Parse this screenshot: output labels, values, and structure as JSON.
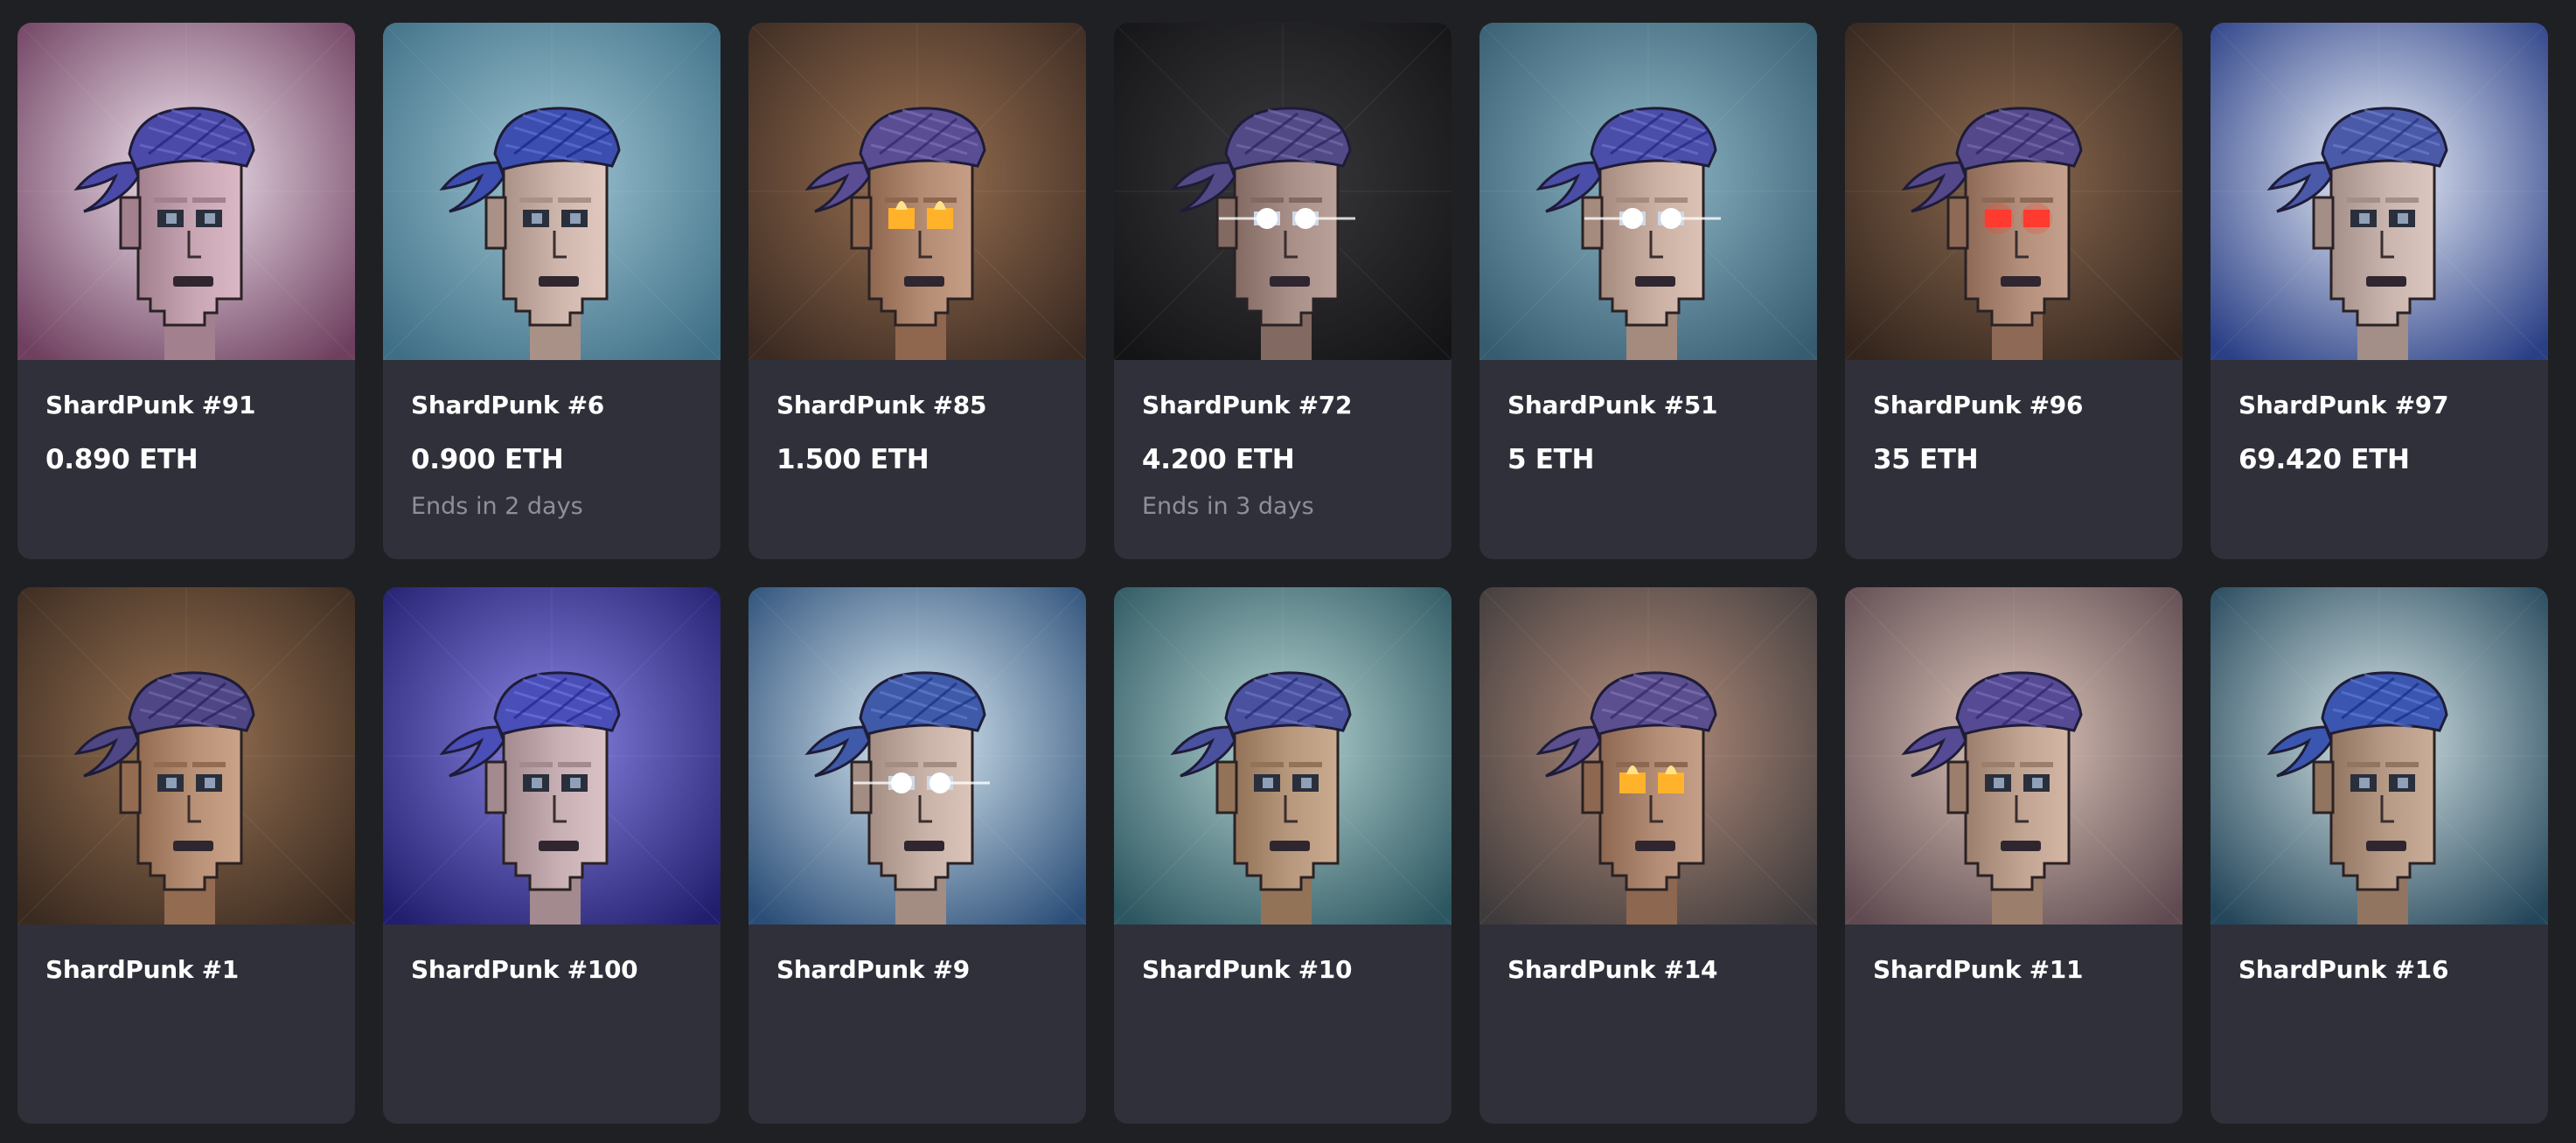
{
  "cards": [
    {
      "name": "ShardPunk #91",
      "price": "0.890 ETH",
      "ends": "",
      "bg1": "#f1e6f0",
      "bg2": "#6e3f5f",
      "bandana": "#4c4aa8",
      "skin": "#c9a6b4",
      "eyes": "normal"
    },
    {
      "name": "ShardPunk #6",
      "price": "0.900 ETH",
      "ends": "Ends in 2 days",
      "bg1": "#9fc6d4",
      "bg2": "#3f6f86",
      "bandana": "#3c4fb0",
      "skin": "#d0b7ad",
      "eyes": "normal"
    },
    {
      "name": "ShardPunk #85",
      "price": "1.500 ETH",
      "ends": "",
      "bg1": "#9b7252",
      "bg2": "#3b2a22",
      "bandana": "#5a4d94",
      "skin": "#b58c74",
      "eyes": "fire"
    },
    {
      "name": "ShardPunk #72",
      "price": "4.200 ETH",
      "ends": "Ends in 3 days",
      "bg1": "#3a3a3e",
      "bg2": "#141416",
      "bandana": "#514a86",
      "skin": "#a88f87",
      "eyes": "laser"
    },
    {
      "name": "ShardPunk #51",
      "price": "5 ETH",
      "ends": "",
      "bg1": "#8fb8c7",
      "bg2": "#365c70",
      "bandana": "#4a4ea8",
      "skin": "#cbb0a4",
      "eyes": "laser"
    },
    {
      "name": "ShardPunk #96",
      "price": "35 ETH",
      "ends": "",
      "bg1": "#8c6a50",
      "bg2": "#33251d",
      "bandana": "#55488a",
      "skin": "#b4907c",
      "eyes": "red"
    },
    {
      "name": "ShardPunk #97",
      "price": "69.420 ETH",
      "ends": "",
      "bg1": "#eef3fb",
      "bg2": "#2a3f86",
      "bandana": "#4a5aa9",
      "skin": "#c9b4ae",
      "eyes": "normal"
    },
    {
      "name": "ShardPunk #1",
      "price": "",
      "ends": "",
      "bg1": "#9a7454",
      "bg2": "#3a2a20",
      "bandana": "#4f4686",
      "skin": "#b89176",
      "eyes": "normal"
    },
    {
      "name": "ShardPunk #100",
      "price": "",
      "ends": "",
      "bg1": "#8a86e4",
      "bg2": "#221e6e",
      "bandana": "#4a4eb8",
      "skin": "#c8b0b4",
      "eyes": "normal"
    },
    {
      "name": "ShardPunk #9",
      "price": "",
      "ends": "",
      "bg1": "#dcecf4",
      "bg2": "#2b4e78",
      "bandana": "#3f5aa8",
      "skin": "#c9b3a8",
      "eyes": "laser"
    },
    {
      "name": "ShardPunk #10",
      "price": "",
      "ends": "",
      "bg1": "#b7d6d4",
      "bg2": "#2c5660",
      "bandana": "#4a52a0",
      "skin": "#b9997e",
      "eyes": "normal"
    },
    {
      "name": "ShardPunk #14",
      "price": "",
      "ends": "",
      "bg1": "#b8907e",
      "bg2": "#3f3b3c",
      "bandana": "#5b4f90",
      "skin": "#b38d75",
      "eyes": "fire"
    },
    {
      "name": "ShardPunk #11",
      "price": "",
      "ends": "",
      "bg1": "#e0c8bc",
      "bg2": "#5e4a50",
      "bandana": "#564a94",
      "skin": "#c2a493",
      "eyes": "normal"
    },
    {
      "name": "ShardPunk #16",
      "price": "",
      "ends": "",
      "bg1": "#d7e6e8",
      "bg2": "#24465a",
      "bandana": "#3a56b0",
      "skin": "#b79b86",
      "eyes": "normal"
    }
  ]
}
